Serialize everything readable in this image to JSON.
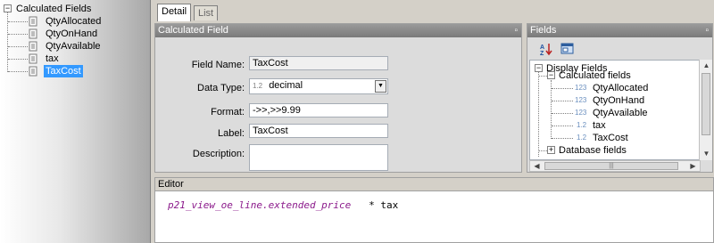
{
  "left_tree": {
    "root_label": "Calculated Fields",
    "items": [
      {
        "label": "QtyAllocated"
      },
      {
        "label": "QtyOnHand"
      },
      {
        "label": "QtyAvailable"
      },
      {
        "label": "tax"
      },
      {
        "label": "TaxCost",
        "selected": true
      }
    ]
  },
  "tabs": [
    {
      "label": "Detail",
      "active": true
    },
    {
      "label": "List",
      "active": false
    }
  ],
  "calc_panel": {
    "title": "Calculated Field",
    "pin_icon": "pin-icon",
    "field_name_label": "Field Name:",
    "field_name_value": "TaxCost",
    "data_type_label": "Data Type:",
    "data_type_badge": "1.2",
    "data_type_value": "decimal",
    "format_label": "Format:",
    "format_value": "->>,>>9.99",
    "label_label": "Label:",
    "label_value": "TaxCost",
    "description_label": "Description:",
    "description_value": ""
  },
  "fields_panel": {
    "title": "Fields",
    "sort_button": "sort-az-icon",
    "properties_button": "properties-icon",
    "tree": {
      "root_label": "Display Fields",
      "group_label": "Calculated fields",
      "items": [
        {
          "badge": "123",
          "label": "QtyAllocated"
        },
        {
          "badge": "123",
          "label": "QtyOnHand"
        },
        {
          "badge": "123",
          "label": "QtyAvailable"
        },
        {
          "badge": "1.2",
          "label": "tax"
        },
        {
          "badge": "1.2",
          "label": "TaxCost"
        }
      ],
      "next_group_label": "Database fields"
    }
  },
  "editor": {
    "title": "Editor",
    "expression_field": "p21_view_oe_line.extended_price",
    "expression_rest": "   * tax"
  },
  "colors": {
    "selection": "#3399ff",
    "header_bg": "#8a8a8a",
    "keyword": "#8b1a8b"
  }
}
